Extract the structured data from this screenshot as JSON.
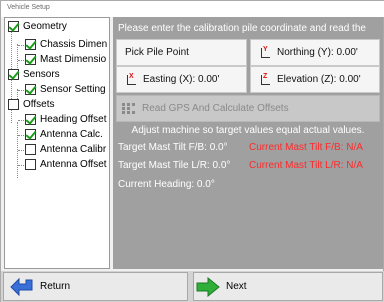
{
  "window": {
    "title": "Vehicle Setup"
  },
  "tree": {
    "items": [
      {
        "label": "Geometry",
        "checked": true,
        "level": 0
      },
      {
        "label": "Chassis Dimen",
        "checked": true,
        "level": 1
      },
      {
        "label": "Mast Dimensio",
        "checked": true,
        "level": 1
      },
      {
        "label": "Sensors",
        "checked": true,
        "level": 0
      },
      {
        "label": "Sensor Setting",
        "checked": true,
        "level": 1
      },
      {
        "label": "Offsets",
        "checked": false,
        "level": 0
      },
      {
        "label": "Heading Offset",
        "checked": true,
        "level": 1
      },
      {
        "label": "Antenna Calc.",
        "checked": true,
        "level": 1
      },
      {
        "label": "Antenna Calibr",
        "checked": false,
        "level": 1
      },
      {
        "label": "Antenna Offset",
        "checked": false,
        "level": 1
      }
    ]
  },
  "main": {
    "instruction": "Please enter the calibration pile coordinate and read the",
    "pick_pile_point": "Pick Pile Point",
    "northing": {
      "axis": "Y",
      "label": "Northing (Y): 0.00'"
    },
    "easting": {
      "axis": "X",
      "label": "Easting (X): 0.00'"
    },
    "elevation": {
      "axis": "Z",
      "label": "Elevation (Z): 0.00'"
    },
    "read_gps_button": "Read GPS And Calculate Offsets",
    "adjust_text": "Adjust machine so target values equal actual values.",
    "target_tilt_fb": "Target Mast Tilt F/B: 0.0°",
    "current_tilt_fb": "Current Mast Tilt F/B: N/A",
    "target_tilt_lr": "Target Mast Tile L/R: 0.0°",
    "current_tilt_lr": "Current Mast Tilt L/R: N/A",
    "current_heading": "Current Heading: 0.0°"
  },
  "footer": {
    "return_label": "Return",
    "next_label": "Next"
  },
  "colors": {
    "panel_bg": "#a0a0a0",
    "status_red": "#ff2a2a",
    "check_green": "#1a9e1a",
    "next_arrow_green": "#2fae3a",
    "return_arrow_blue": "#3a6fd8"
  },
  "icons": {
    "axis": "axis-icon",
    "gps": "gps-grid-icon",
    "return": "return-arrow-icon",
    "next": "next-arrow-icon"
  }
}
